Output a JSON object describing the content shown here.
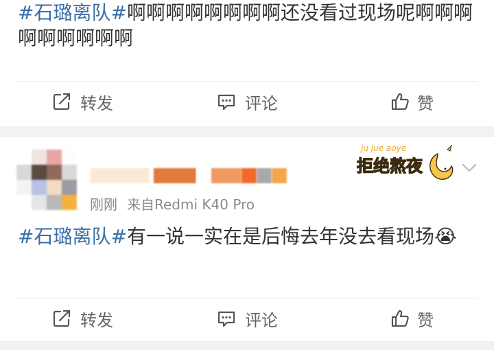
{
  "post1": {
    "topic": "#石璐离队#",
    "text": "啊啊啊啊啊啊啊啊还没看过现场呢啊啊啊啊啊啊啊啊啊"
  },
  "post2": {
    "topic": "#石璐离队#",
    "text": "有一说一实在是后悔去年没去看现场",
    "emoji": "😭",
    "time": "刚刚",
    "source": "来自Redmi K40 Pro",
    "badge_pinyin": "ju jue aoye",
    "badge_text": "拒绝熬夜"
  },
  "actions": {
    "repost": "转发",
    "comment": "评论",
    "like": "赞"
  },
  "colors": {
    "topic": "#3a6ea5",
    "action_text": "#666666",
    "meta_text": "#8a8a8a",
    "badge_fill": "#f7b526"
  },
  "icons": [
    "repost-icon",
    "comment-icon",
    "like-icon",
    "chevron-down-icon"
  ]
}
